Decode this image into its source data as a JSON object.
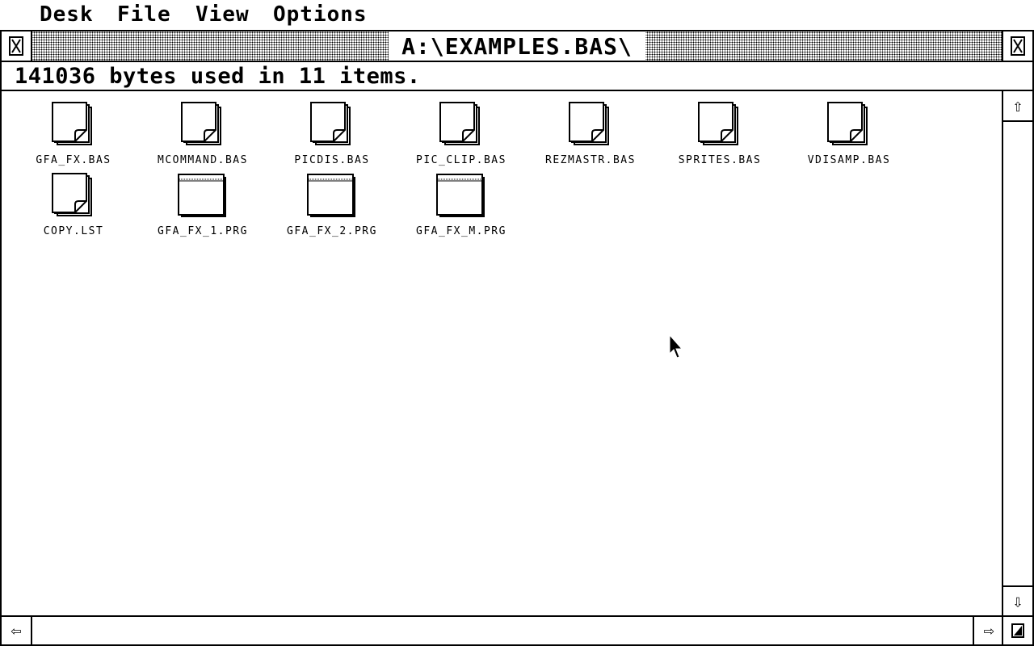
{
  "menu": {
    "items": [
      "Desk",
      "File",
      "View",
      "Options"
    ]
  },
  "window": {
    "title": "A:\\EXAMPLES.BAS\\",
    "info": "141036 bytes used in 11 items.",
    "closer_icon": "close-box-icon",
    "fuller_icon": "full-box-icon"
  },
  "files": [
    {
      "name": "GFA_FX.BAS",
      "icon": "document-icon"
    },
    {
      "name": "MCOMMAND.BAS",
      "icon": "document-icon"
    },
    {
      "name": "PICDIS.BAS",
      "icon": "document-icon"
    },
    {
      "name": "PIC_CLIP.BAS",
      "icon": "document-icon"
    },
    {
      "name": "REZMASTR.BAS",
      "icon": "document-icon"
    },
    {
      "name": "SPRITES.BAS",
      "icon": "document-icon"
    },
    {
      "name": "VDISAMP.BAS",
      "icon": "document-icon"
    },
    {
      "name": "COPY.LST",
      "icon": "document-icon"
    },
    {
      "name": "GFA_FX_1.PRG",
      "icon": "program-icon"
    },
    {
      "name": "GFA_FX_2.PRG",
      "icon": "program-icon"
    },
    {
      "name": "GFA_FX_M.PRG",
      "icon": "program-icon"
    }
  ],
  "scrollbars": {
    "up": "⇧",
    "down": "⇩",
    "left": "⇦",
    "right": "⇨"
  }
}
